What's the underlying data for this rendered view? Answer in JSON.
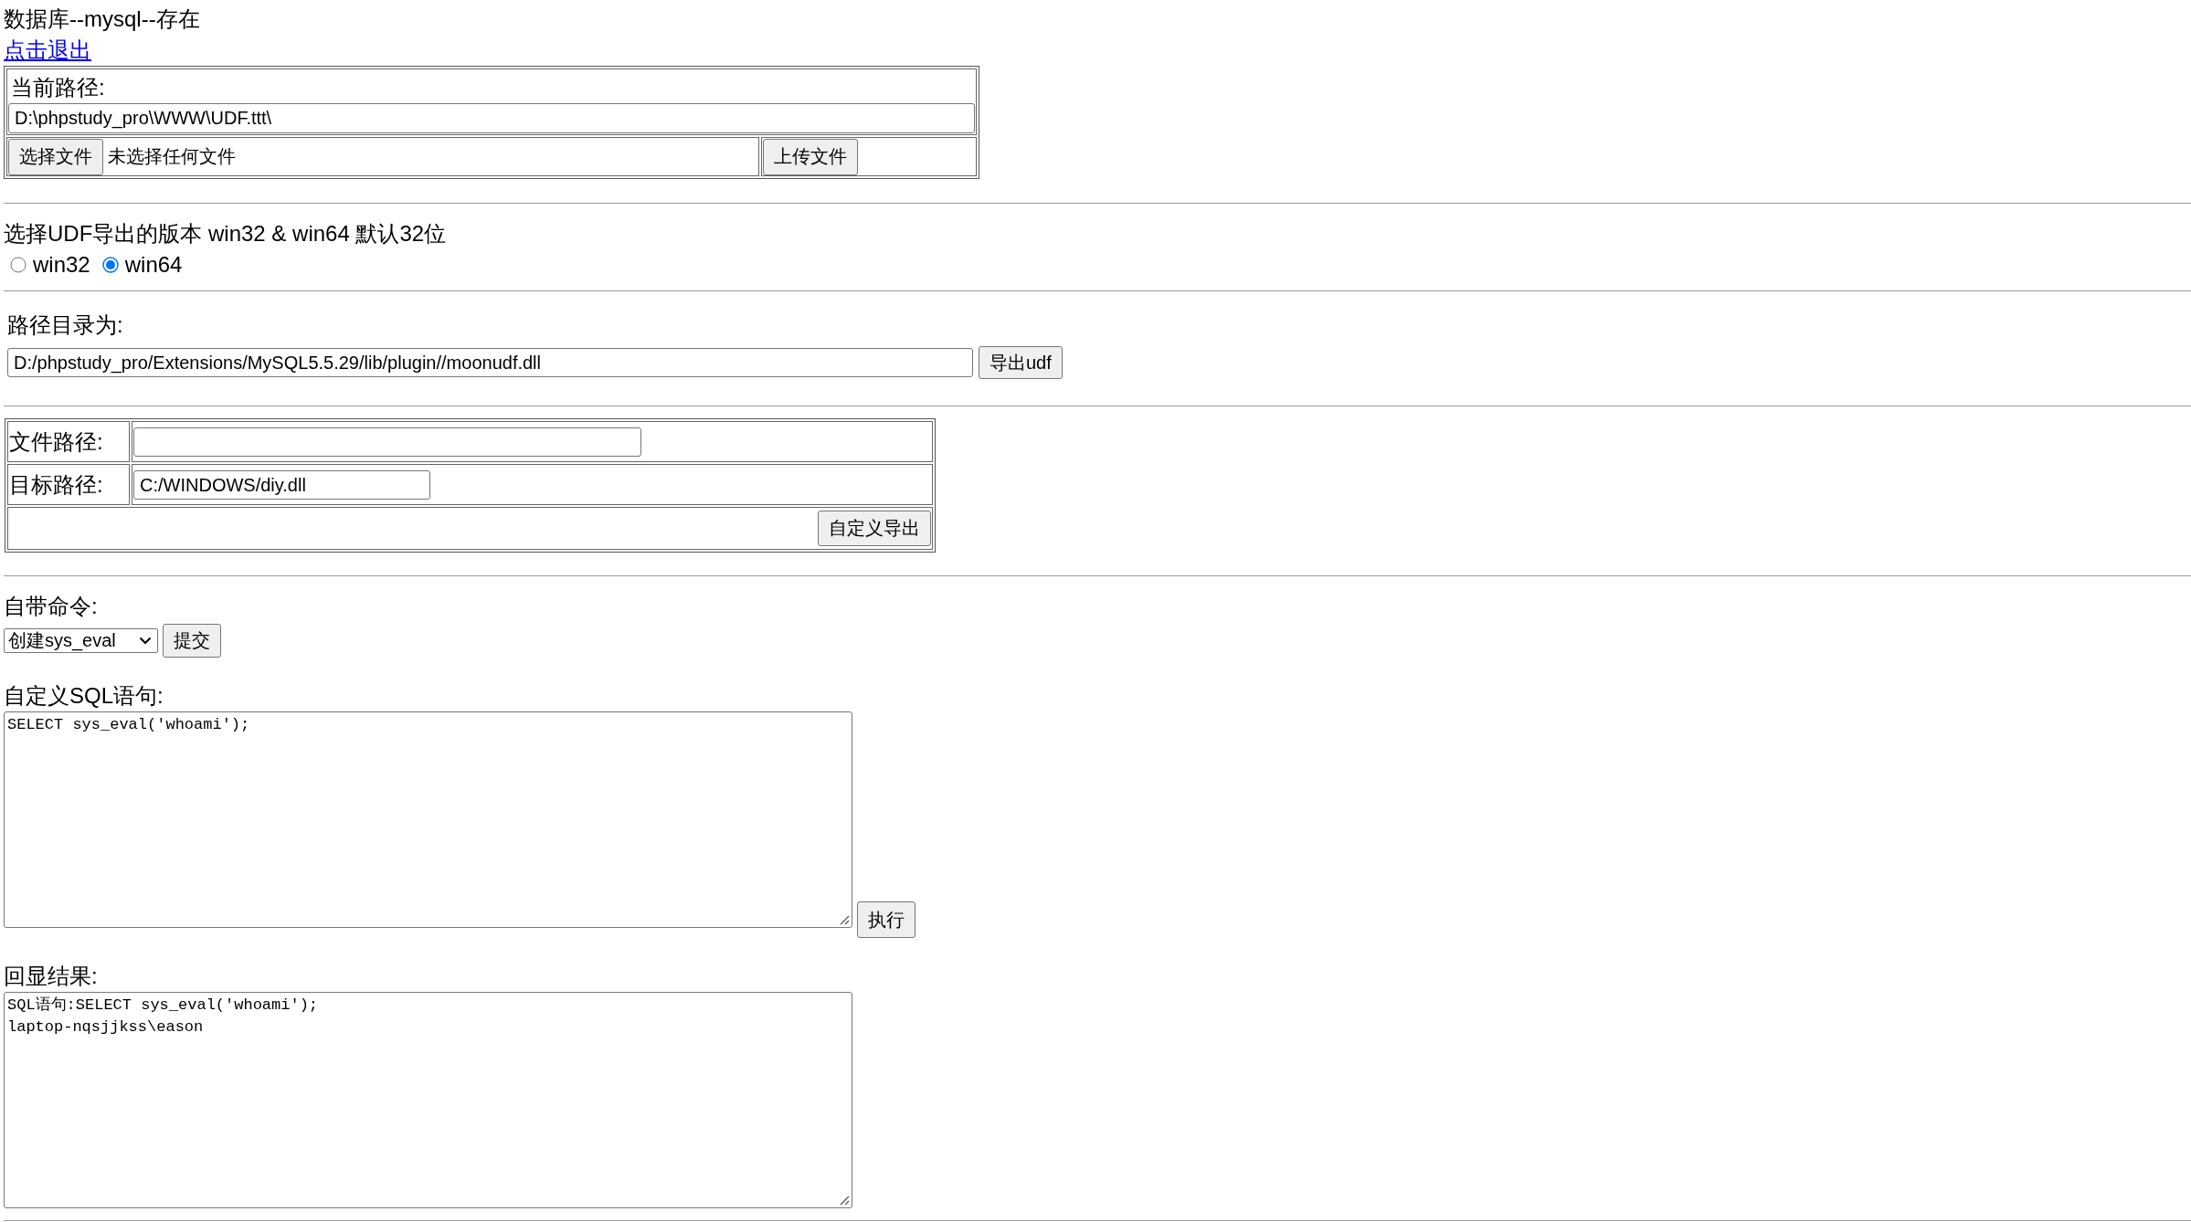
{
  "header": {
    "title": "数据库--mysql--存在",
    "logout_link": "点击退出"
  },
  "upload_form": {
    "path_label": "当前路径:",
    "path_field": {
      "value": "D:\\phpstudy_pro\\WWW\\UDF.ttt\\"
    },
    "file_picker": {
      "button": "选择文件",
      "status": "未选择任何文件"
    },
    "upload_button": "上传文件"
  },
  "udf_version": {
    "prompt": "选择UDF导出的版本 win32 & win64 默认32位",
    "options": [
      {
        "label": "win32",
        "selected": false
      },
      {
        "label": "win64",
        "selected": true
      }
    ]
  },
  "udf_export": {
    "label": "路径目录为:",
    "path_field": {
      "value": "D:/phpstudy_pro/Extensions/MySQL5.5.29/lib/plugin//moonudf.dll"
    },
    "button": "导出udf"
  },
  "custom_export": {
    "rows": [
      {
        "label": "文件路径:"
      },
      {
        "label": "目标路径:",
        "value": "C:/WINDOWS/diy.dll"
      }
    ],
    "button": "自定义导出"
  },
  "builtin_command": {
    "label": "自带命令:",
    "select": {
      "value": "创建sys_eval"
    },
    "button": "提交"
  },
  "custom_sql": {
    "label": "自定义SQL语句:",
    "textarea": {
      "value": "SELECT sys_eval('whoami');"
    },
    "button": "执行"
  },
  "result": {
    "label": "回显结果:",
    "textarea": {
      "lines": [
        "SQL语句:SELECT sys_eval('whoami');",
        "laptop-nqsjjkss\\eason"
      ]
    }
  }
}
